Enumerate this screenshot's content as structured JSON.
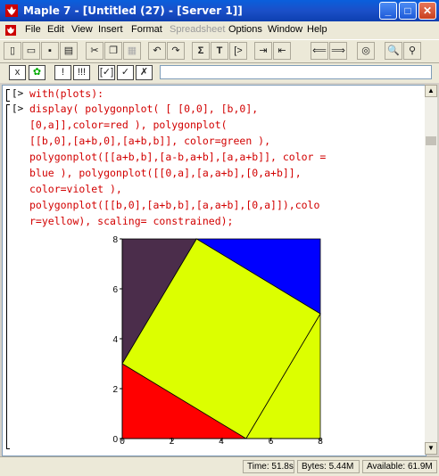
{
  "window": {
    "title": "Maple 7  - [Untitled (27) - [Server 1]]",
    "minimize_glyph": "_",
    "maximize_glyph": "□",
    "close_glyph": "✕"
  },
  "menu": {
    "items": [
      "File",
      "Edit",
      "View",
      "Insert",
      "Format",
      "Spreadsheet",
      "Options",
      "Window",
      "Help"
    ]
  },
  "toolbar1": {
    "buttons": [
      "new-icon",
      "open-icon",
      "save-icon",
      "print-icon",
      "cut-icon",
      "copy-icon",
      "paste-icon",
      "undo-icon",
      "redo-icon",
      "text-icon",
      "sigma-icon",
      "T-icon",
      "prompt-icon",
      "indent-icon",
      "outdent-icon",
      "back-icon",
      "forward-icon",
      "stop-icon",
      "zoom-in-icon",
      "zoom-out-icon"
    ],
    "labels": {
      "sigma": "Σ",
      "text": "T",
      "prompt": "[>"
    }
  },
  "toolbar2": {
    "labels": {
      "x": "x",
      "stop": "✿",
      "excl": "!",
      "excl_multi": "!!!",
      "check1": "[✓]",
      "check2": "✓",
      "cross": "✗"
    },
    "context_value": ""
  },
  "worksheet": {
    "input1": "with(plots):",
    "input2": "display( polygonplot( [ [0,0], [b,0],\n[0,a]],color=red ), polygonplot(\n[[b,0],[a+b,0],[a+b,b]], color=green ),\npolygonplot([[a+b,b],[a-b,a+b],[a,a+b]], color =\nblue ), polygonplot([[0,a],[a,a+b],[0,a+b]],\ncolor=violet ),\npolygonplot([[b,0],[a+b,b],[a,a+b],[0,a]]),colo\nr=yellow), scaling= constrained);",
    "prompt": "[>"
  },
  "chart_data": {
    "type": "area",
    "xlim": [
      0,
      8
    ],
    "ylim": [
      0,
      8
    ],
    "x_ticks": [
      "0",
      "2",
      "4",
      "6",
      "8"
    ],
    "y_ticks": [
      "0",
      "2",
      "4",
      "6",
      "8"
    ],
    "polygons": [
      {
        "color": "#ff0000",
        "points": [
          [
            0,
            0
          ],
          [
            5,
            0
          ],
          [
            0,
            3
          ]
        ]
      },
      {
        "color": "#4b2d4b",
        "points": [
          [
            0,
            3
          ],
          [
            3,
            8
          ],
          [
            0,
            8
          ]
        ]
      },
      {
        "color": "#0000ff",
        "points": [
          [
            3,
            8
          ],
          [
            8,
            8
          ],
          [
            8,
            5
          ]
        ]
      },
      {
        "color": "#dcff00",
        "points": [
          [
            5,
            0
          ],
          [
            8,
            0
          ],
          [
            8,
            5
          ]
        ]
      },
      {
        "color": "#dcff00",
        "points": [
          [
            5,
            0
          ],
          [
            8,
            5
          ],
          [
            3,
            8
          ],
          [
            0,
            3
          ]
        ]
      }
    ]
  },
  "status": {
    "time": "Time: 51.8s",
    "bytes": "Bytes: 5.44M",
    "available": "Available: 61.9M"
  }
}
